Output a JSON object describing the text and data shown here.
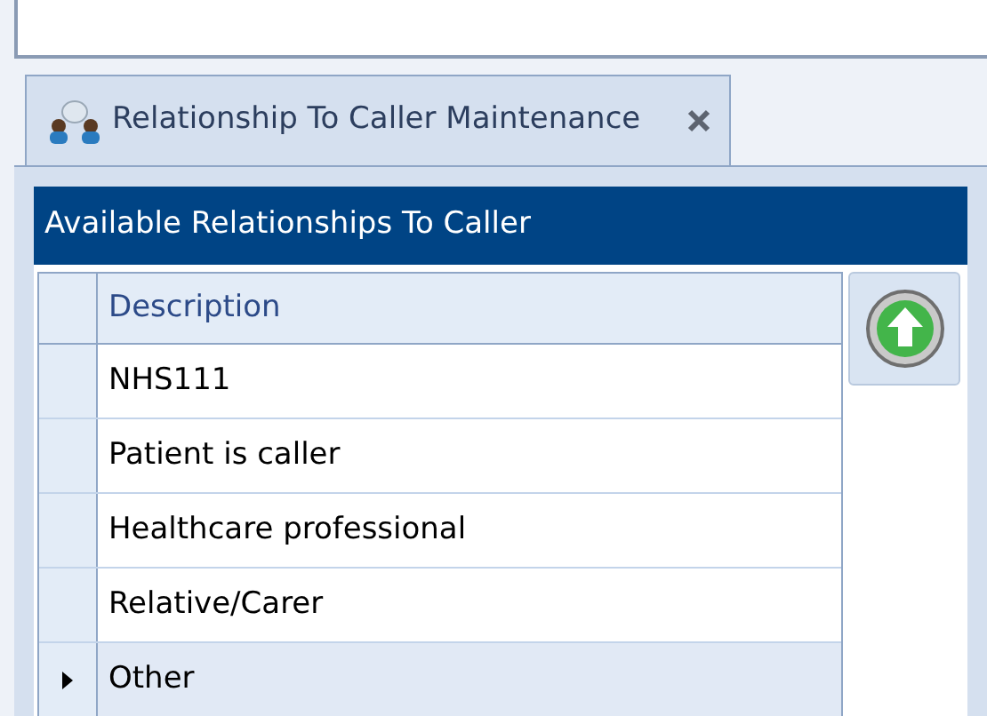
{
  "tab": {
    "title": "Relationship To Caller Maintenance",
    "selected": true
  },
  "panel": {
    "title": "Available Relationships To Caller"
  },
  "table": {
    "columns": [
      "Description"
    ],
    "rows": [
      {
        "description": "NHS111",
        "selected": false
      },
      {
        "description": "Patient is caller",
        "selected": false
      },
      {
        "description": "Healthcare professional",
        "selected": false
      },
      {
        "description": "Relative/Carer",
        "selected": false
      },
      {
        "description": "Other",
        "selected": true
      }
    ]
  }
}
